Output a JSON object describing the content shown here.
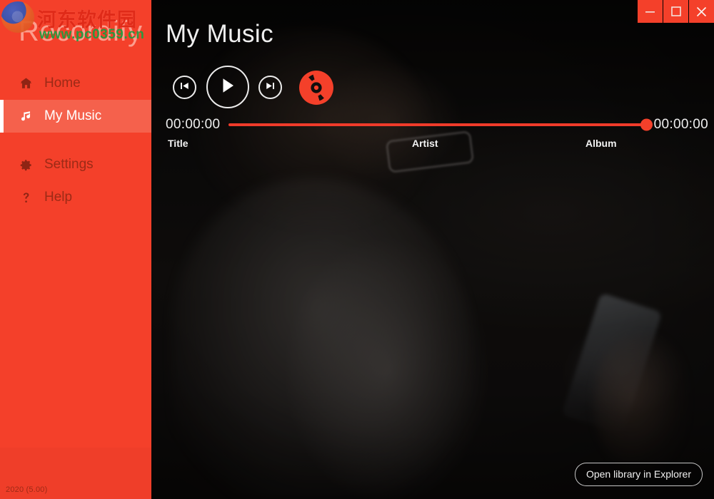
{
  "window": {
    "buttons": [
      {
        "name": "minimize",
        "icon": "minimize-icon",
        "label": "Minimize"
      },
      {
        "name": "maximize",
        "icon": "maximize-icon",
        "label": "Maximize"
      },
      {
        "name": "close",
        "icon": "close-icon",
        "label": "Close"
      }
    ]
  },
  "sidebar": {
    "brand": "Recordify",
    "version": "2020 (5.00)",
    "items": [
      {
        "label": "Home",
        "icon": "home-icon",
        "active": false
      },
      {
        "label": "My Music",
        "icon": "music-note-icon",
        "active": true
      },
      {
        "label": "Settings",
        "icon": "gear-icon",
        "active": false
      },
      {
        "label": "Help",
        "icon": "question-mark-icon",
        "active": false
      }
    ]
  },
  "watermark": {
    "site_name": "河东软件园",
    "url": "www.pc0359.cn"
  },
  "main": {
    "title": "My Music",
    "player": {
      "previous_label": "Previous",
      "play_label": "Play",
      "next_label": "Next",
      "record_label": "Record",
      "elapsed_time": "00:00:00",
      "total_time": "00:00:00",
      "progress_percent": 100
    },
    "columns": [
      {
        "label": "Title"
      },
      {
        "label": "Artist"
      },
      {
        "label": "Album"
      }
    ],
    "tracks": [],
    "open_library_label": "Open library in Explorer"
  },
  "colors": {
    "accent": "#f4402a",
    "accent_active": "#f5614c",
    "sidebar_text": "#9c2a16",
    "content_bg": "#100e0d",
    "seek_bar": "#ef3b2a",
    "watermark_red": "#e02a18",
    "watermark_green": "#1f9d3f"
  }
}
